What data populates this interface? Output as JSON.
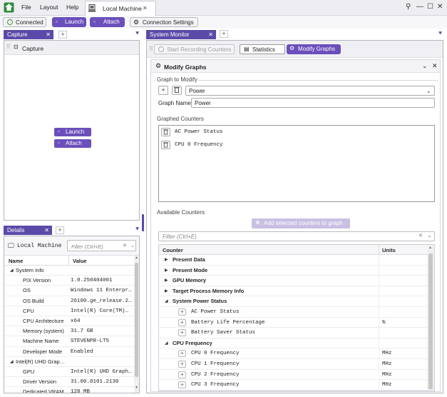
{
  "menu": {
    "file": "File",
    "layout": "Layout",
    "help": "Help"
  },
  "tab": {
    "label": "Local Machine",
    "close": "✕"
  },
  "window_controls": {
    "pin": "⚲",
    "minimize": "—",
    "maximize": "☐",
    "close": "✕"
  },
  "toolbar": {
    "connected": "Connected",
    "launch": "Launch",
    "attach": "Attach",
    "connection_settings": "Connection Settings"
  },
  "capture_panel": {
    "tab": "Capture",
    "header": "Capture",
    "launch": "Launch",
    "attach": "Attach"
  },
  "details_panel": {
    "tab": "Details",
    "machine": "Local Machine",
    "filter_placeholder": "Filter (Ctrl+E)",
    "col_name": "Name",
    "col_value": "Value",
    "rows": [
      {
        "name": "System Info",
        "value": "",
        "group": true
      },
      {
        "name": "PIX Version",
        "value": "1.0.250404001"
      },
      {
        "name": "OS",
        "value": "Windows 11 Enterpr…"
      },
      {
        "name": "OS Build",
        "value": "26100.ge_release.2…"
      },
      {
        "name": "CPU",
        "value": "Intel(R) Core(TM)…"
      },
      {
        "name": "CPU Architecture",
        "value": "x64"
      },
      {
        "name": "Memory (system)",
        "value": "31.7 GB"
      },
      {
        "name": "Machine Name",
        "value": "STEVENPR-LT5"
      },
      {
        "name": "Developer Mode",
        "value": "Enabled"
      },
      {
        "name": "Intel(R) UHD Grap…",
        "value": "",
        "group": true
      },
      {
        "name": "GPU",
        "value": "Intel(R) UHD Graph…"
      },
      {
        "name": "Driver Version",
        "value": "31.00.0101.2130"
      },
      {
        "name": "Dedicated VRAM",
        "value": "128 MB"
      }
    ]
  },
  "system_monitor": {
    "tab": "System Monitor",
    "start_recording": "Start Recording Counters",
    "statistics": "Statistics",
    "modify_graphs": "Modify Graphs",
    "title": "Modify Graphs",
    "graph_to_modify_label": "Graph to Modify",
    "graph_selected": "Power",
    "graph_name_label": "Graph Name",
    "graph_name_value": "Power",
    "graphed_counters_label": "Graphed Counters",
    "graphed_counters": [
      "AC Power Status",
      "CPU 0 Frequency"
    ],
    "available_counters_label": "Available Counters",
    "add_selected": "Add selected counters to graph",
    "filter_placeholder": "Filter (Ctrl+E)",
    "col_counter": "Counter",
    "col_units": "Units",
    "counters": [
      {
        "name": "Present Data",
        "units": "",
        "type": "group-collapsed"
      },
      {
        "name": "Present Mode",
        "units": "",
        "type": "group-collapsed"
      },
      {
        "name": "GPU Memory",
        "units": "",
        "type": "group-collapsed"
      },
      {
        "name": "Target Process Memory Info",
        "units": "",
        "type": "group-collapsed"
      },
      {
        "name": "System Power Status",
        "units": "",
        "type": "group-expanded"
      },
      {
        "name": "AC Power Status",
        "units": "",
        "type": "item"
      },
      {
        "name": "Battery Life Percentage",
        "units": "%",
        "type": "item"
      },
      {
        "name": "Battery Saver Status",
        "units": "",
        "type": "item"
      },
      {
        "name": "CPU Frequency",
        "units": "",
        "type": "group-expanded"
      },
      {
        "name": "CPU 0 Frequency",
        "units": "MHz",
        "type": "item"
      },
      {
        "name": "CPU 1 Frequency",
        "units": "MHz",
        "type": "item"
      },
      {
        "name": "CPU 2 Frequency",
        "units": "MHz",
        "type": "item"
      },
      {
        "name": "CPU 3 Frequency",
        "units": "MHz",
        "type": "item"
      }
    ]
  },
  "colors": {
    "accent": "#6b4fbb",
    "tab": "#5c4aa8",
    "connected": "#3a9a3a"
  }
}
